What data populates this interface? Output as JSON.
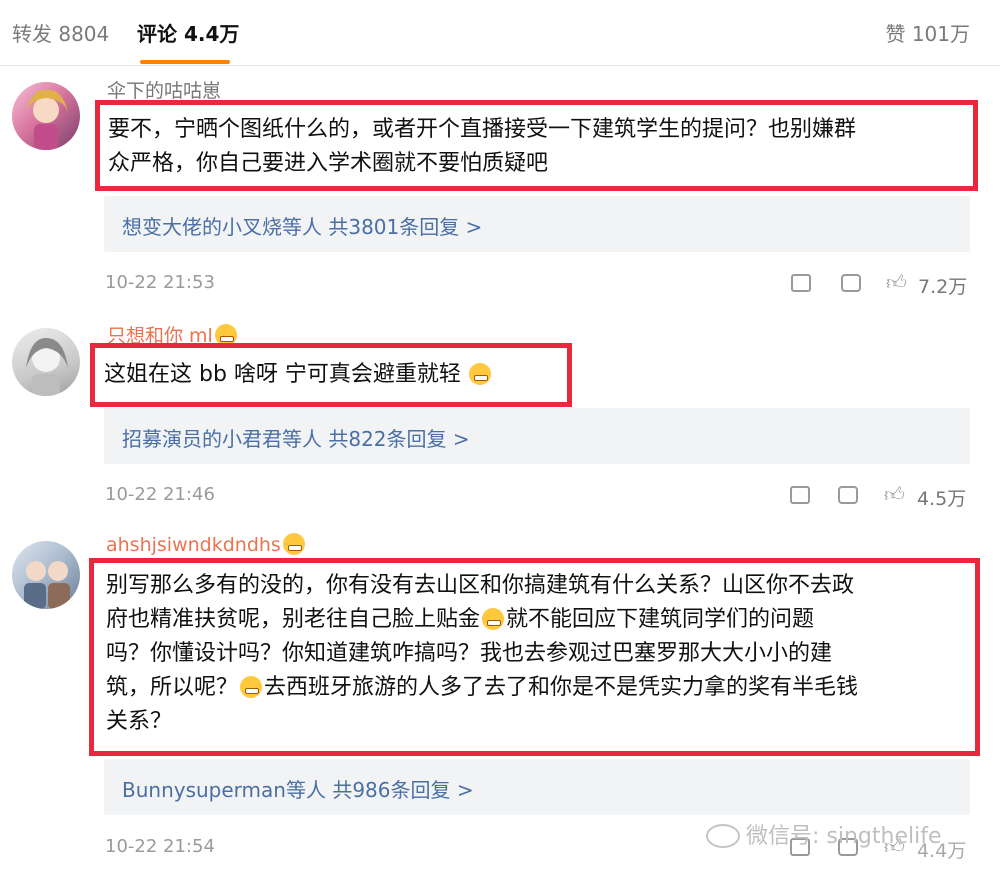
{
  "tabs": {
    "repost": "转发 8804",
    "comments": "评论 4.4万",
    "likes": "赞 101万"
  },
  "comments": [
    {
      "username": "伞下的咕咕崽",
      "text_line1": "要不，宁晒个图纸什么的，或者开个直播接受一下建筑学生的提问？也别嫌群",
      "text_line2": "众严格，你自己要进入学术圈就不要怕质疑吧",
      "replies": "想变大佬的小叉烧等人  共3801条回复 >",
      "time": "10-22 21:53",
      "likes": "7.2万"
    },
    {
      "username": "只想和你 ml",
      "text_line1": "这姐在这 bb 啥呀  宁可真会避重就轻",
      "replies": "招募演员的小君君等人  共822条回复 >",
      "time": "10-22 21:46",
      "likes": "4.5万"
    },
    {
      "username": "ahshjsiwndkdndhs",
      "text_line1": "别写那么多有的没的，你有没有去山区和你搞建筑有什么关系？山区你不去政",
      "text_line2": "府也精准扶贫呢，别老往自己脸上贴金",
      "text_line2b": "就不能回应下建筑同学们的问题",
      "text_line3": "吗？你懂设计吗？你知道建筑咋搞吗？我也去参观过巴塞罗那大大小小的建",
      "text_line4": "筑，所以呢？",
      "text_line4b": "去西班牙旅游的人多了去了和你是不是凭实力拿的奖有半毛钱",
      "text_line5": "关系？",
      "replies": "Bunnysuperman等人  共986条回复 >",
      "time": "10-22 21:54",
      "likes": "4.4万"
    }
  ],
  "watermark": "微信号: singthelife",
  "colors": {
    "highlight": "#e8283c",
    "link": "#4a6fa5",
    "username_orange": "#eb7350",
    "tab_indicator": "#ff8200"
  },
  "icons": [
    "share-icon",
    "comment-icon",
    "thumbs-up-icon",
    "wechat-icon",
    "grin-emoji-icon"
  ]
}
